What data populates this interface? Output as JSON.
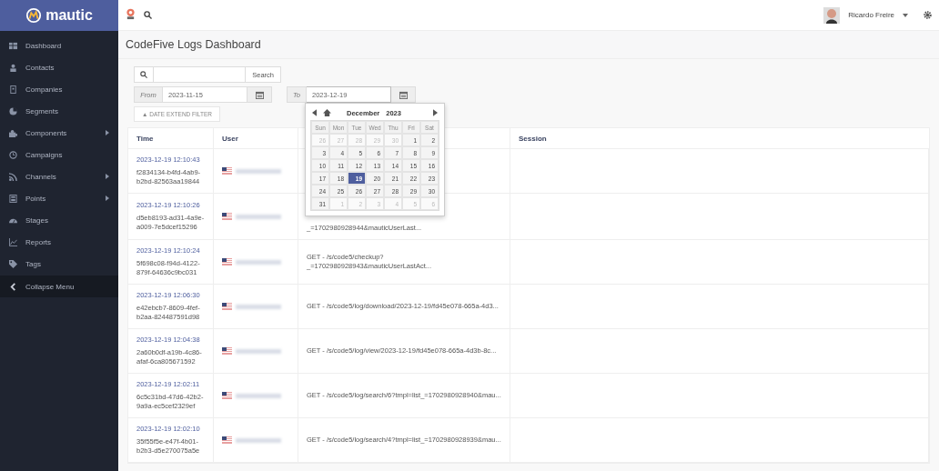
{
  "brand": {
    "name": "mautic"
  },
  "sidebar": {
    "items": [
      {
        "label": "Dashboard",
        "submenu": false
      },
      {
        "label": "Contacts",
        "submenu": false
      },
      {
        "label": "Companies",
        "submenu": false
      },
      {
        "label": "Segments",
        "submenu": false
      },
      {
        "label": "Components",
        "submenu": true
      },
      {
        "label": "Campaigns",
        "submenu": false
      },
      {
        "label": "Channels",
        "submenu": true
      },
      {
        "label": "Points",
        "submenu": true
      },
      {
        "label": "Stages",
        "submenu": false
      },
      {
        "label": "Reports",
        "submenu": false
      },
      {
        "label": "Tags",
        "submenu": false
      }
    ],
    "collapse": "Collapse Menu"
  },
  "topbar": {
    "user": "Ricardo Freire"
  },
  "page_title": "CodeFive Logs Dashboard",
  "search": {
    "button": "Search"
  },
  "from": {
    "label": "From",
    "value": "2023-11-15"
  },
  "to": {
    "label": "To",
    "value": "2023-12-19"
  },
  "extend_filter": "▲ DATE EXTEND FILTER",
  "calendar": {
    "month": "December",
    "year": "2023",
    "weekdays": [
      "Sun",
      "Mon",
      "Tue",
      "Wed",
      "Thu",
      "Fri",
      "Sat"
    ],
    "days": [
      {
        "label": "26",
        "muted": true,
        "selected": false
      },
      {
        "label": "27",
        "muted": true,
        "selected": false
      },
      {
        "label": "28",
        "muted": true,
        "selected": false
      },
      {
        "label": "29",
        "muted": true,
        "selected": false
      },
      {
        "label": "30",
        "muted": true,
        "selected": false
      },
      {
        "label": "1",
        "muted": false,
        "selected": false
      },
      {
        "label": "2",
        "muted": false,
        "selected": false
      },
      {
        "label": "3",
        "muted": false,
        "selected": false
      },
      {
        "label": "4",
        "muted": false,
        "selected": false
      },
      {
        "label": "5",
        "muted": false,
        "selected": false
      },
      {
        "label": "6",
        "muted": false,
        "selected": false
      },
      {
        "label": "7",
        "muted": false,
        "selected": false
      },
      {
        "label": "8",
        "muted": false,
        "selected": false
      },
      {
        "label": "9",
        "muted": false,
        "selected": false
      },
      {
        "label": "10",
        "muted": false,
        "selected": false
      },
      {
        "label": "11",
        "muted": false,
        "selected": false
      },
      {
        "label": "12",
        "muted": false,
        "selected": false
      },
      {
        "label": "13",
        "muted": false,
        "selected": false
      },
      {
        "label": "14",
        "muted": false,
        "selected": false
      },
      {
        "label": "15",
        "muted": false,
        "selected": false
      },
      {
        "label": "16",
        "muted": false,
        "selected": false
      },
      {
        "label": "17",
        "muted": false,
        "selected": false
      },
      {
        "label": "18",
        "muted": false,
        "selected": false
      },
      {
        "label": "19",
        "muted": false,
        "selected": true
      },
      {
        "label": "20",
        "muted": false,
        "selected": false
      },
      {
        "label": "21",
        "muted": false,
        "selected": false
      },
      {
        "label": "22",
        "muted": false,
        "selected": false
      },
      {
        "label": "23",
        "muted": false,
        "selected": false
      },
      {
        "label": "24",
        "muted": false,
        "selected": false
      },
      {
        "label": "25",
        "muted": false,
        "selected": false
      },
      {
        "label": "26",
        "muted": false,
        "selected": false
      },
      {
        "label": "27",
        "muted": false,
        "selected": false
      },
      {
        "label": "28",
        "muted": false,
        "selected": false
      },
      {
        "label": "29",
        "muted": false,
        "selected": false
      },
      {
        "label": "30",
        "muted": false,
        "selected": false
      },
      {
        "label": "31",
        "muted": false,
        "selected": false
      },
      {
        "label": "1",
        "muted": true,
        "selected": false
      },
      {
        "label": "2",
        "muted": true,
        "selected": false
      },
      {
        "label": "3",
        "muted": true,
        "selected": false
      },
      {
        "label": "4",
        "muted": true,
        "selected": false
      },
      {
        "label": "5",
        "muted": true,
        "selected": false
      },
      {
        "label": "6",
        "muted": true,
        "selected": false
      }
    ]
  },
  "table": {
    "columns": [
      "Time",
      "User",
      "Session"
    ],
    "rows": [
      {
        "time": "2023-12-19 12:10:43",
        "id": "f2834134-b4fd-4ab9-b2bd-82563aa19844"
      },
      {
        "time": "2023-12-19 12:10:26",
        "id": "d5eb8193-ad31-4a9e-a009-7e5dcef15296",
        "request": "_=1702980928944&mauticUserLast..."
      },
      {
        "time": "2023-12-19 12:10:24",
        "id": "5f698c08-f94d-4122-879f-64636c9bc031",
        "request": "GET - /s/code5/checkup?_=1702980928943&mauticUserLastAct..."
      },
      {
        "time": "2023-12-19 12:06:30",
        "id": "e42ebcb7-8609-4fef-b2aa-824487591d98",
        "request": "GET - /s/code5/log/download/2023-12-19/fd45e078-665a-4d3..."
      },
      {
        "time": "2023-12-19 12:04:38",
        "id": "2a60b0df-a19b-4c86-afaf-6ca805671592",
        "request": "GET - /s/code5/log/view/2023-12-19/fd45e078-665a-4d3b-8c..."
      },
      {
        "time": "2023-12-19 12:02:11",
        "id": "6c5c31bd-47d6-42b2-9a9a-ec5cef2329ef",
        "request": "GET - /s/code5/log/search/6?tmpl=list_=1702980928940&mau..."
      },
      {
        "time": "2023-12-19 12:02:10",
        "id": "35f55f5e-e47f-4b01-b2b3-d5e270075a5e",
        "request": "GET - /s/code5/log/search/4?tmpl=list_=1702980928939&mau..."
      }
    ]
  }
}
